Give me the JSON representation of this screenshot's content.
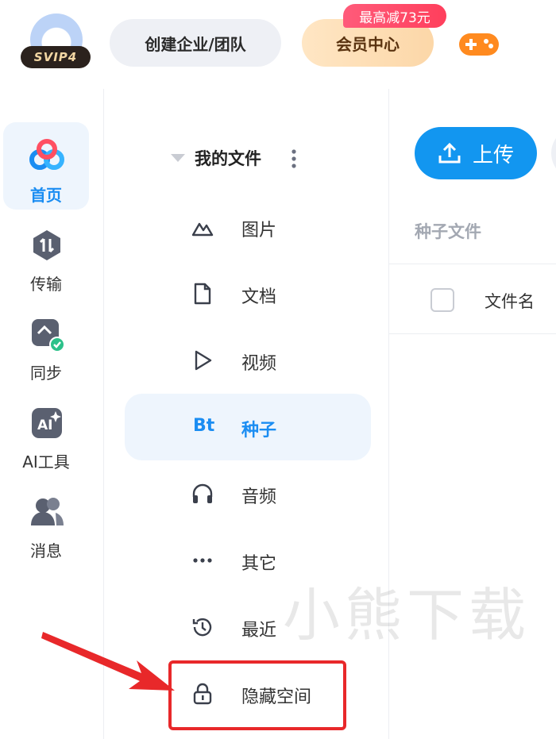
{
  "header": {
    "svip_badge": "SVIP4",
    "team_button": "创建企业/团队",
    "vip_button": "会员中心",
    "promo_tag": "最高减73元",
    "game_icon": "gamepad-icon"
  },
  "rail": {
    "items": [
      {
        "label": "首页",
        "icon": "home-logo-icon",
        "active": true
      },
      {
        "label": "传输",
        "icon": "transfer-icon"
      },
      {
        "label": "同步",
        "icon": "sync-icon"
      },
      {
        "label": "AI工具",
        "icon": "ai-tools-icon"
      },
      {
        "label": "消息",
        "icon": "message-icon"
      }
    ]
  },
  "panel": {
    "title": "我的文件",
    "items": [
      {
        "label": "图片",
        "icon": "image-icon"
      },
      {
        "label": "文档",
        "icon": "document-icon"
      },
      {
        "label": "视频",
        "icon": "video-icon"
      },
      {
        "label": "种子",
        "icon": "bt-icon",
        "icon_text": "Bt",
        "active": true
      },
      {
        "label": "音频",
        "icon": "headphones-icon"
      },
      {
        "label": "其它",
        "icon": "more-icon"
      },
      {
        "label": "最近",
        "icon": "history-icon"
      },
      {
        "label": "隐藏空间",
        "icon": "lock-icon"
      }
    ]
  },
  "main": {
    "upload_label": "上传",
    "section_title": "种子文件",
    "column_name": "文件名"
  },
  "watermark": "小熊下载",
  "colors": {
    "accent": "#1b8df2",
    "active_bg": "#eef5fd",
    "annotation": "#e8282a"
  }
}
